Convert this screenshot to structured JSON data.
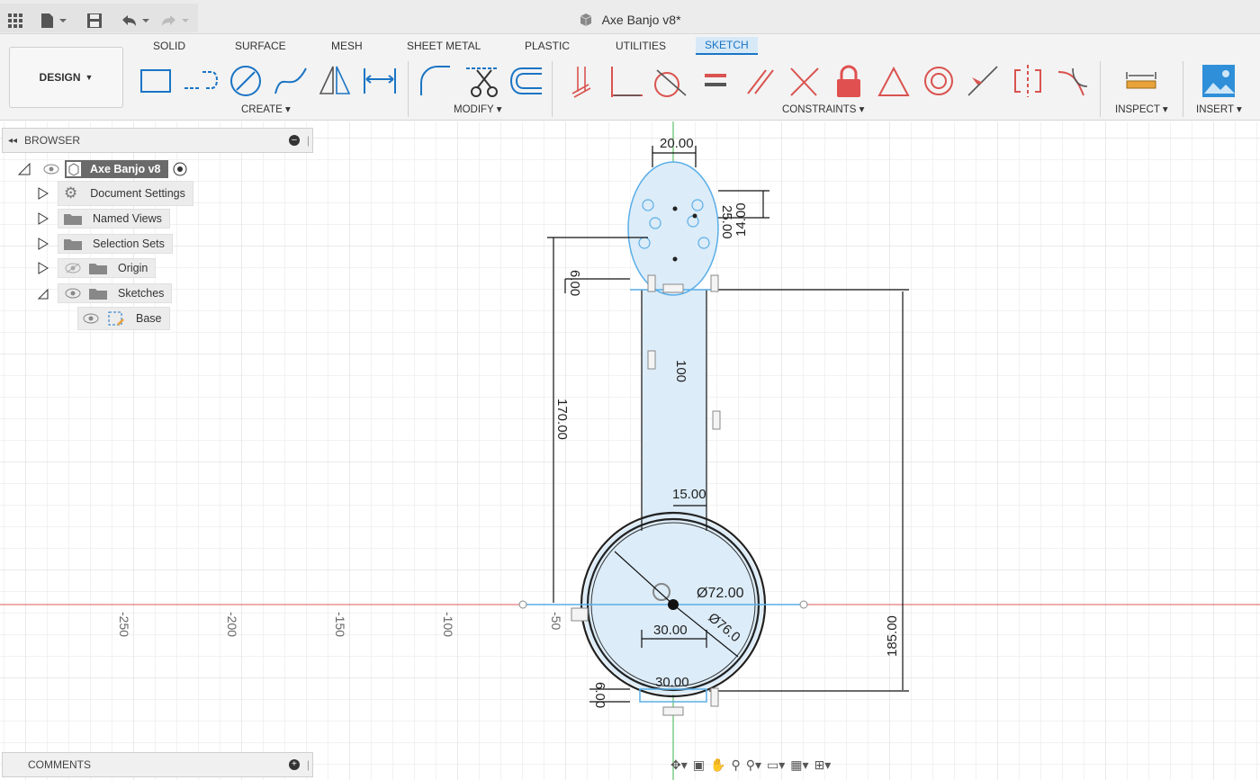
{
  "app": {
    "document_title": "Axe Banjo v8*",
    "design_label": "DESIGN"
  },
  "tabs": [
    {
      "label": "SOLID",
      "active": false
    },
    {
      "label": "SURFACE",
      "active": false
    },
    {
      "label": "MESH",
      "active": false
    },
    {
      "label": "SHEET METAL",
      "active": false
    },
    {
      "label": "PLASTIC",
      "active": false
    },
    {
      "label": "UTILITIES",
      "active": false
    },
    {
      "label": "SKETCH",
      "active": true
    }
  ],
  "groups": {
    "create": "CREATE",
    "modify": "MODIFY",
    "constraints": "CONSTRAINTS",
    "inspect": "INSPECT",
    "insert": "INSERT"
  },
  "browser": {
    "title": "BROWSER",
    "root": "Axe Banjo v8",
    "items": [
      {
        "label": "Document Settings"
      },
      {
        "label": "Named Views"
      },
      {
        "label": "Selection Sets"
      },
      {
        "label": "Origin"
      },
      {
        "label": "Sketches"
      },
      {
        "label": "Base"
      }
    ]
  },
  "comments": {
    "title": "COMMENTS"
  },
  "canvas": {
    "axis_ticks": [
      "-250",
      "-200",
      "-150",
      "-100",
      "-50"
    ],
    "dimensions": [
      "20.00",
      "14.00",
      "25.00",
      "6.00",
      "170.00",
      "100",
      "15.00",
      "Ø72.00",
      "30.00",
      "Ø76.0",
      "30.00",
      "185.00",
      "6.00"
    ]
  },
  "colors": {
    "accent": "#1a74c4",
    "sketch_fill": "#dcecf8",
    "x_axis": "#e05a5a",
    "y_axis": "#3cb44b",
    "grid": "#e6e6e6"
  }
}
